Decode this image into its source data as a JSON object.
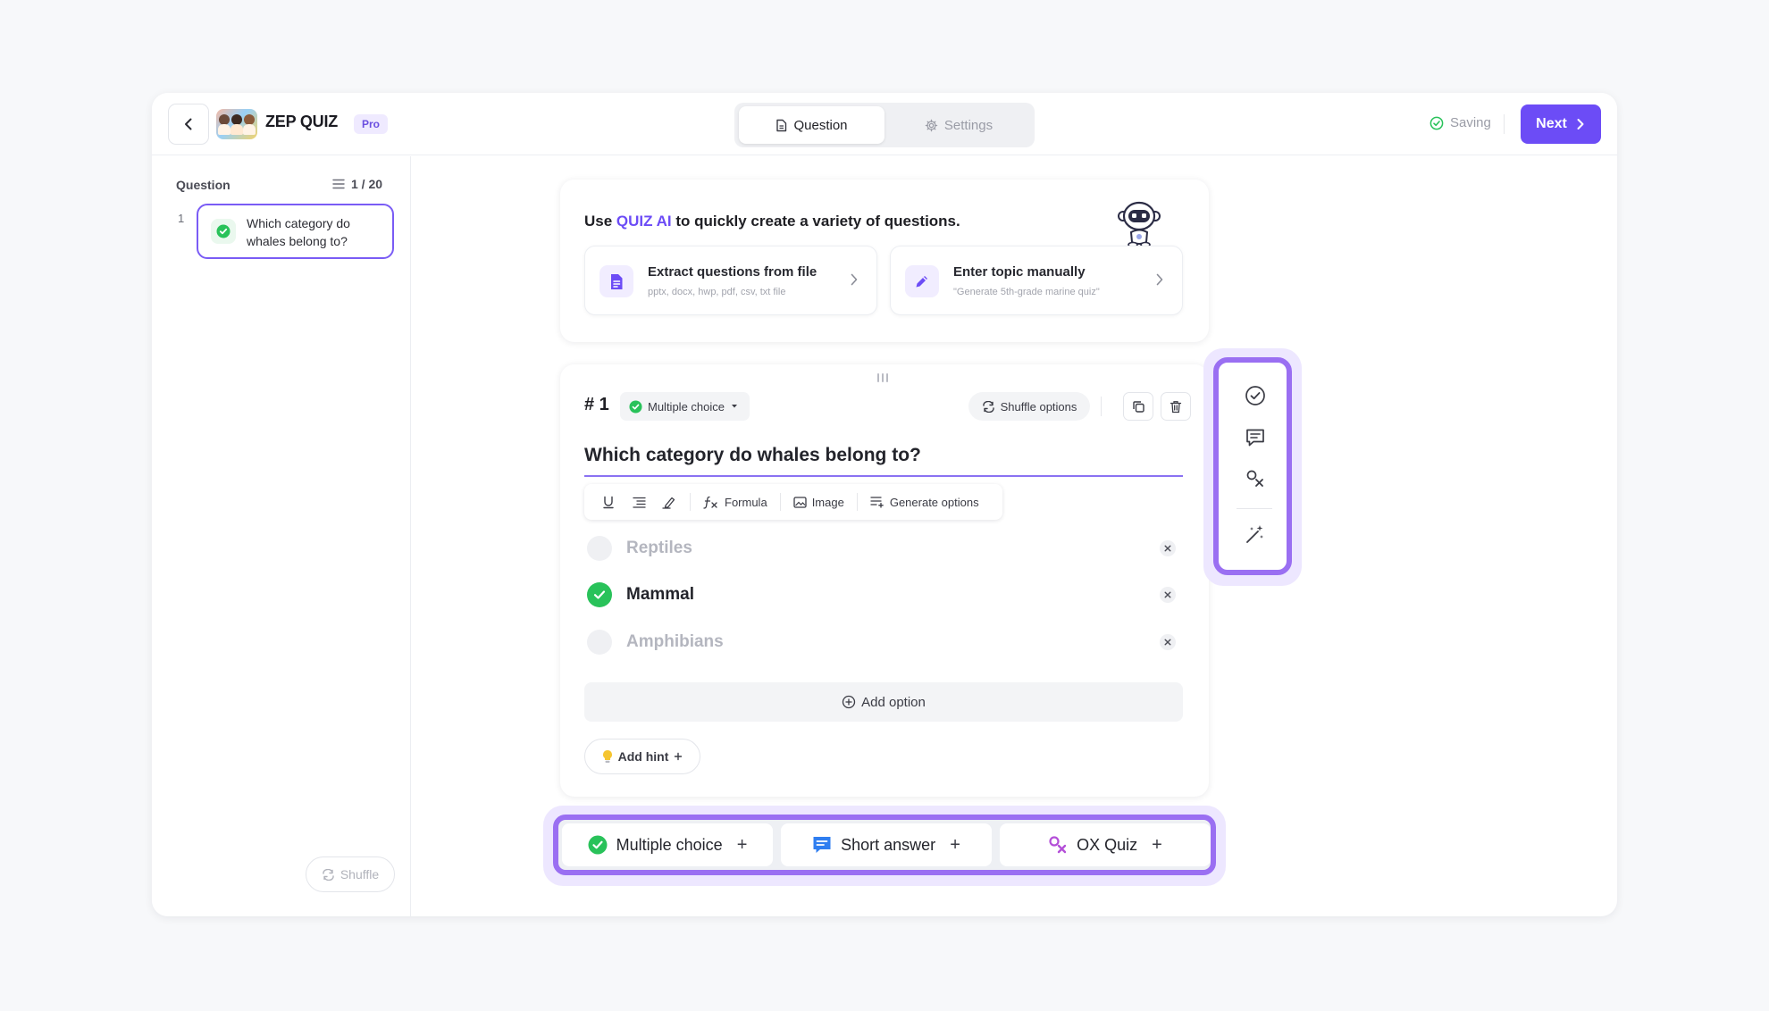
{
  "header": {
    "app_name": "ZEP QUIZ",
    "badge": "Pro",
    "tabs": [
      {
        "label": "Question",
        "icon": "document-icon",
        "active": true
      },
      {
        "label": "Settings",
        "icon": "gear-icon",
        "active": false
      }
    ],
    "status": "Saving",
    "next_label": "Next"
  },
  "sidebar": {
    "title": "Question",
    "count": "1 / 20",
    "items": [
      {
        "number": "1",
        "text": "Which category do whales belong to?"
      }
    ],
    "shuffle_label": "Shuffle"
  },
  "ai_card": {
    "title_prefix": "Use ",
    "title_highlight": "QUIZ AI",
    "title_suffix": " to quickly create a variety of questions.",
    "options": [
      {
        "title": "Extract questions from file",
        "subtitle": "pptx, docx, hwp, pdf, csv, txt file",
        "icon": "file-icon"
      },
      {
        "title": "Enter topic manually",
        "subtitle": "\"Generate 5th-grade marine quiz\"",
        "icon": "pencil-icon"
      }
    ]
  },
  "question": {
    "number": "# 1",
    "type": "Multiple choice",
    "shuffle_label": "Shuffle options",
    "text": "Which category do whales belong to?",
    "toolbar": {
      "formula": "Formula",
      "image": "Image",
      "generate": "Generate options"
    },
    "options": [
      {
        "label": "Reptiles",
        "correct": false
      },
      {
        "label": "Mammal",
        "correct": true
      },
      {
        "label": "Amphibians",
        "correct": false
      }
    ],
    "add_option_label": "Add option",
    "add_hint_label": "Add hint"
  },
  "bottom_bar": {
    "items": [
      {
        "label": "Multiple choice",
        "icon": "check-circle-icon"
      },
      {
        "label": "Short answer",
        "icon": "chat-icon"
      },
      {
        "label": "OX Quiz",
        "icon": "ox-icon"
      }
    ]
  },
  "colors": {
    "accent": "#6c4cf6",
    "highlight_border": "#9a6ff2",
    "success": "#29c25a",
    "short_answer": "#2f7ef0",
    "ox": "#b44fd8"
  }
}
